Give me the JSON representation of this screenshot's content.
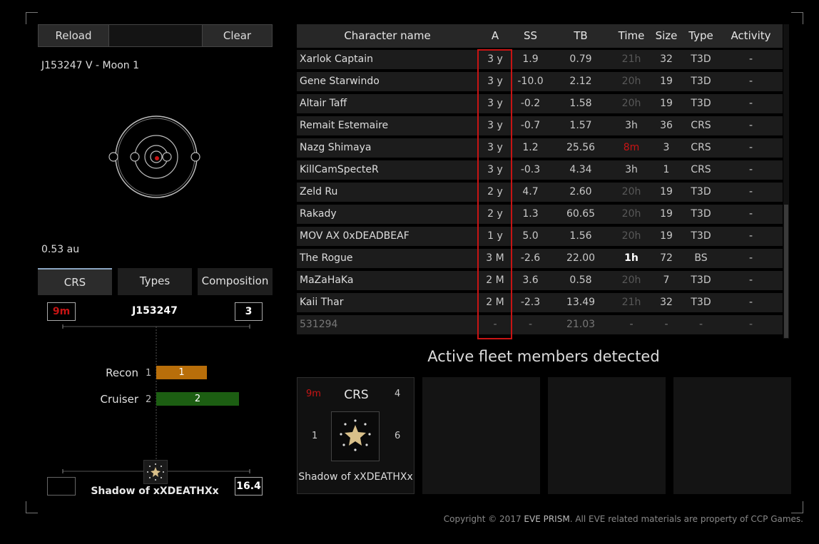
{
  "toolbar": {
    "reload_label": "Reload",
    "clear_label": "Clear"
  },
  "location": "J153247 V - Moon 1",
  "distance": "0.53 au",
  "tabs": [
    {
      "label": "CRS",
      "active": true
    },
    {
      "label": "Types",
      "active": false
    },
    {
      "label": "Composition",
      "active": false
    }
  ],
  "crs": {
    "time": "9m",
    "system": "J153247",
    "count": "3",
    "bars": [
      {
        "label": "Recon",
        "count": "1",
        "value": "1",
        "color": "#b86e0a"
      },
      {
        "label": "Cruiser",
        "count": "2",
        "value": "2",
        "color": "#1c5e12"
      }
    ],
    "pilot": "Shadow of xXDEATHXx",
    "score": "16.4"
  },
  "table": {
    "headers": [
      "Character name",
      "A",
      "SS",
      "TB",
      "Time",
      "Size",
      "Type",
      "Activity"
    ],
    "rows": [
      {
        "name": "Xarlok Captain",
        "a": "3 y",
        "ss": "1.9",
        "tb": "0.79",
        "time": "21h",
        "time_style": "dim",
        "size": "32",
        "type": "T3D",
        "activity": "-"
      },
      {
        "name": "Gene Starwindo",
        "a": "3 y",
        "ss": "-10.0",
        "tb": "2.12",
        "time": "20h",
        "time_style": "dim",
        "size": "19",
        "type": "T3D",
        "activity": "-"
      },
      {
        "name": "Altair Taff",
        "a": "3 y",
        "ss": "-0.2",
        "tb": "1.58",
        "time": "20h",
        "time_style": "dim",
        "size": "19",
        "type": "T3D",
        "activity": "-"
      },
      {
        "name": "Remait Estemaire",
        "a": "3 y",
        "ss": "-0.7",
        "tb": "1.57",
        "time": "3h",
        "time_style": "normal",
        "size": "36",
        "type": "CRS",
        "activity": "-"
      },
      {
        "name": "Nazg Shimaya",
        "a": "3 y",
        "ss": "1.2",
        "tb": "25.56",
        "time": "8m",
        "time_style": "red",
        "size": "3",
        "type": "CRS",
        "activity": "-"
      },
      {
        "name": "KillCamSpecteR",
        "a": "3 y",
        "ss": "-0.3",
        "tb": "4.34",
        "time": "3h",
        "time_style": "normal",
        "size": "1",
        "type": "CRS",
        "activity": "-"
      },
      {
        "name": "Zeld Ru",
        "a": "2 y",
        "ss": "4.7",
        "tb": "2.60",
        "time": "20h",
        "time_style": "dim",
        "size": "19",
        "type": "T3D",
        "activity": "-"
      },
      {
        "name": "Rakady",
        "a": "2 y",
        "ss": "1.3",
        "tb": "60.65",
        "time": "20h",
        "time_style": "dim",
        "size": "19",
        "type": "T3D",
        "activity": "-"
      },
      {
        "name": "MOV AX 0xDEADBEAF",
        "a": "1 y",
        "ss": "5.0",
        "tb": "1.56",
        "time": "20h",
        "time_style": "dim",
        "size": "19",
        "type": "T3D",
        "activity": "-"
      },
      {
        "name": "The Rogue",
        "a": "3 M",
        "ss": "-2.6",
        "tb": "22.00",
        "time": "1h",
        "time_style": "bold",
        "size": "72",
        "type": "BS",
        "activity": "-"
      },
      {
        "name": "MaZaHaKa",
        "a": "2 M",
        "ss": "3.6",
        "tb": "0.58",
        "time": "20h",
        "time_style": "dim",
        "size": "7",
        "type": "T3D",
        "activity": "-"
      },
      {
        "name": "Kaii Thar",
        "a": "2 M",
        "ss": "-2.3",
        "tb": "13.49",
        "time": "21h",
        "time_style": "dim",
        "size": "32",
        "type": "T3D",
        "activity": "-"
      },
      {
        "name": "531294",
        "a": "-",
        "ss": "-",
        "tb": "21.03",
        "time": "-",
        "time_style": "normal",
        "size": "-",
        "type": "-",
        "activity": "-"
      }
    ]
  },
  "fleet": {
    "title": "Active fleet members detected",
    "card": {
      "time": "9m",
      "type": "CRS",
      "top_right": "4",
      "left": "1",
      "right": "6",
      "name": "Shadow of xXDEATHXx"
    }
  },
  "footer": {
    "prefix": "Copyright © 2017 ",
    "brand": "EVE PRISM",
    "suffix": ". All EVE related materials are property of CCP Games."
  },
  "colors": {
    "accent_red": "#c81414",
    "tab_accent": "#8aa4c0"
  }
}
